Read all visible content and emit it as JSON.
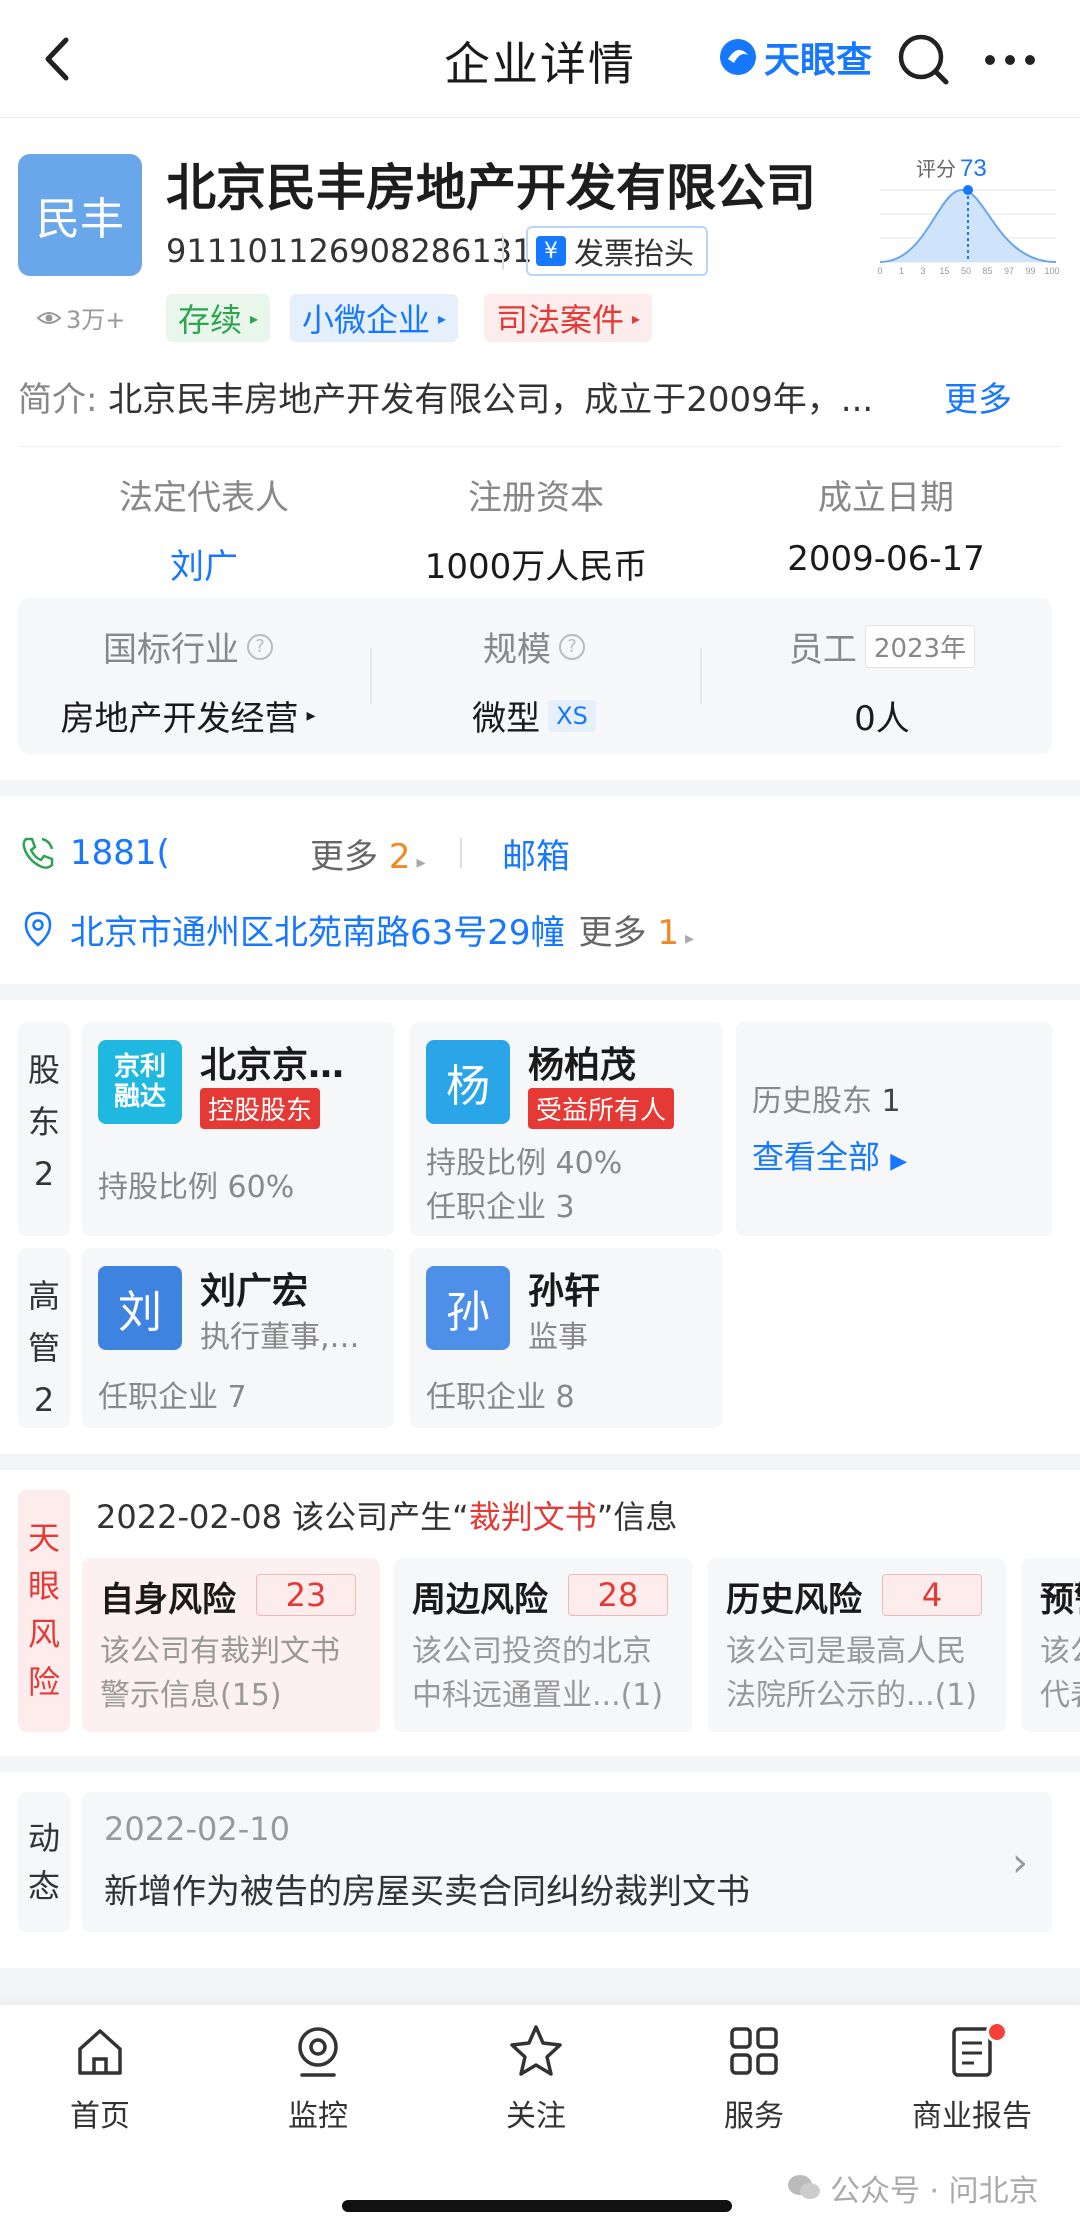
{
  "header": {
    "title": "企业详情",
    "brand": "天眼查"
  },
  "company": {
    "logo_text": "民丰",
    "name": "北京民丰房地产开发有限公司",
    "credit_code": "911101126908286131",
    "invoice_label": "发票抬头",
    "score_label": "评分",
    "score": "73",
    "score_axis": [
      "0",
      "1",
      "3",
      "15",
      "50",
      "85",
      "97",
      "99",
      "100"
    ],
    "views": "3万+",
    "tags": [
      "存续",
      "小微企业",
      "司法案件"
    ],
    "intro_label": "简介:",
    "intro": "北京民丰房地产开发有限公司，成立于2009年，...",
    "intro_more": "更多"
  },
  "basic": {
    "legal_rep_label": "法定代表人",
    "legal_rep": "刘广",
    "capital_label": "注册资本",
    "capital": "1000万人民币",
    "founded_label": "成立日期",
    "founded": "2009-06-17"
  },
  "industry": {
    "industry_label": "国标行业",
    "industry": "房地产开发经营",
    "scale_label": "规模",
    "scale": "微型",
    "scale_badge": "XS",
    "staff_label": "员工",
    "staff_year": "2023年",
    "staff": "0人"
  },
  "contact": {
    "phone": "1881(",
    "phone_more": "更多",
    "phone_more_count": "2",
    "email_label": "邮箱",
    "address": "北京市通州区北苑南路63号29幢",
    "addr_more": "更多",
    "addr_more_count": "1"
  },
  "shareholders": {
    "label": "股东",
    "count": "2",
    "items": [
      {
        "avatar": "京利融达",
        "name": "北京京…",
        "role": "控股股东",
        "line1": "持股比例 60%"
      },
      {
        "avatar": "杨",
        "name": "杨柏茂",
        "role": "受益所有人",
        "line1": "持股比例 40%",
        "line2": "任职企业 3"
      }
    ],
    "history_label": "历史股东",
    "history_count": "1",
    "view_all": "查看全部"
  },
  "executives": {
    "label": "高管",
    "count": "2",
    "items": [
      {
        "avatar": "刘",
        "name": "刘广宏",
        "title": "执行董事,…",
        "line1": "任职企业 7"
      },
      {
        "avatar": "孙",
        "name": "孙轩",
        "title": "监事",
        "line1": "任职企业 8"
      }
    ]
  },
  "risk": {
    "label": "天眼风险",
    "headline_pre": "2022-02-08 该公司产生“",
    "headline_hl": "裁判文书",
    "headline_post": "”信息",
    "cards": [
      {
        "title": "自身风险",
        "count": "23",
        "desc1": "该公司有裁判文书",
        "desc2": "警示信息(15)"
      },
      {
        "title": "周边风险",
        "count": "28",
        "desc1": "该公司投资的北京",
        "desc2": "中科远通置业...(1)"
      },
      {
        "title": "历史风险",
        "count": "4",
        "desc1": "该公司是最高人民",
        "desc2": "法院所公示的...(1)"
      },
      {
        "title": "预警",
        "desc1": "该公",
        "desc2": "代表"
      }
    ]
  },
  "news": {
    "label": "动态",
    "date": "2022-02-10",
    "text": "新增作为被告的房屋买卖合同纠纷裁判文书"
  },
  "nav": {
    "items": [
      "首页",
      "监控",
      "关注",
      "服务",
      "商业报告"
    ]
  },
  "watermark": "公众号 · 问北京",
  "colors": {
    "accent": "#1677ff",
    "danger": "#e53935",
    "success": "#2ea44f",
    "warning": "#f08a24"
  }
}
